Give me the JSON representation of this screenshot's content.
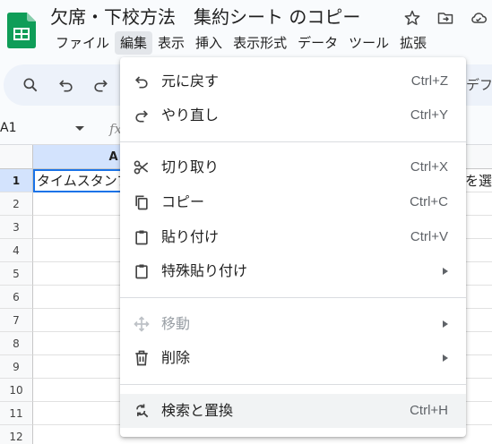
{
  "document": {
    "title": "欠席・下校方法　集約シート のコピー"
  },
  "menubar": {
    "items": [
      "ファイル",
      "編集",
      "表示",
      "挿入",
      "表示形式",
      "データ",
      "ツール",
      "拡張"
    ]
  },
  "toolbar": {
    "font_fragment": "デフ"
  },
  "formula_bar": {
    "name_box": "A1",
    "fx": "fx"
  },
  "grid": {
    "column_a": "A",
    "rows": [
      "1",
      "2",
      "3",
      "4",
      "5",
      "6",
      "7",
      "8",
      "9",
      "10",
      "11",
      "12"
    ],
    "cell_a1": "タイムスタンプ",
    "row1_right_fragment": "を選択"
  },
  "edit_menu": {
    "items": [
      {
        "label": "元に戻す",
        "shortcut": "Ctrl+Z",
        "icon": "undo-icon"
      },
      {
        "label": "やり直し",
        "shortcut": "Ctrl+Y",
        "icon": "redo-icon"
      },
      {
        "label": "切り取り",
        "shortcut": "Ctrl+X",
        "icon": "scissors-icon"
      },
      {
        "label": "コピー",
        "shortcut": "Ctrl+C",
        "icon": "copy-icon"
      },
      {
        "label": "貼り付け",
        "shortcut": "Ctrl+V",
        "icon": "clipboard-icon"
      },
      {
        "label": "特殊貼り付け",
        "icon": "clipboard-icon",
        "submenu": true
      },
      {
        "label": "移動",
        "icon": "move-icon",
        "submenu": true,
        "disabled": true
      },
      {
        "label": "削除",
        "icon": "trash-icon",
        "submenu": true
      },
      {
        "label": "検索と置換",
        "shortcut": "Ctrl+H",
        "icon": "find-replace-icon"
      }
    ]
  },
  "colors": {
    "accent": "#1a73e8",
    "selection": "#d3e3fd",
    "toolbar_bg": "#edf2fa",
    "logo_green": "#0f9d58"
  }
}
